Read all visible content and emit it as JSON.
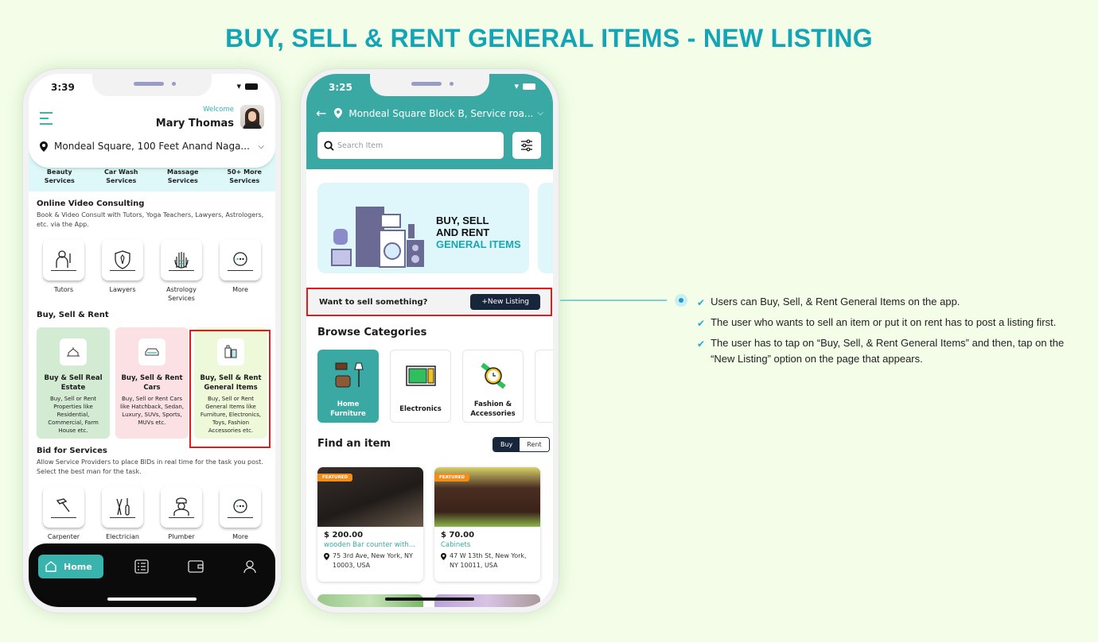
{
  "page": {
    "title": "BUY, SELL & RENT GENERAL ITEMS - NEW LISTING",
    "accent_color": "#14a5b5"
  },
  "left_phone": {
    "status_time": "3:39",
    "header": {
      "welcome": "Welcome",
      "user_name": "Mary Thomas",
      "location": "Mondeal Square, 100 Feet Anand Naga..."
    },
    "services_strip": [
      "Beauty Services",
      "Car Wash Services",
      "Massage Services",
      "50+ More Services"
    ],
    "online_video": {
      "title": "Online Video Consulting",
      "description": "Book & Video Consult with Tutors, Yoga Teachers, Lawyers, Astrologers, etc. via the App.",
      "items": [
        {
          "label": "Tutors",
          "icon": "tutor-icon"
        },
        {
          "label": "Lawyers",
          "icon": "lawyer-shield-icon"
        },
        {
          "label": "Astrology Services",
          "icon": "astrology-hand-icon"
        },
        {
          "label": "More",
          "icon": "more-icon"
        }
      ]
    },
    "buy_sell_rent": {
      "title": "Buy, Sell & Rent",
      "cards": [
        {
          "title": "Buy & Sell Real Estate",
          "description": "Buy, Sell or Rent Properties like Residential, Commercial, Farm House etc.",
          "bg": "#d3ebd3"
        },
        {
          "title": "Buy, Sell & Rent Cars",
          "description": "Buy, Sell or Rent Cars like Hatchback, Sedan, Luxury, SUVs, Sports, MUVs  etc.",
          "bg": "#fbe1e3"
        },
        {
          "title": "Buy, Sell & Rent General Items",
          "description": "Buy, Sell or Rent General Items like Furniture, Electronics, Toys, Fashion Accessories  etc.",
          "bg": "#eef9d9"
        }
      ]
    },
    "bid_services": {
      "title": "Bid for Services",
      "description": "Allow Service Providers to place BIDs in real time for the task you post. Select the best man for the task.",
      "items": [
        {
          "label": "Carpenter",
          "icon": "carpenter-hammer-icon"
        },
        {
          "label": "Electrician",
          "icon": "electrician-tools-icon"
        },
        {
          "label": "Plumber",
          "icon": "plumber-icon"
        },
        {
          "label": "More",
          "icon": "more-icon"
        }
      ]
    },
    "bottom_nav": {
      "home_label": "Home",
      "items": [
        "home-icon",
        "tasks-list-icon",
        "wallet-icon",
        "profile-icon"
      ]
    }
  },
  "right_phone": {
    "status_time": "3:25",
    "location": "Mondeal Square Block B, Service roa...",
    "search_placeholder": "Search Item",
    "banner": {
      "line1": "BUY, SELL",
      "line2": "AND RENT",
      "line3": "GENERAL ITEMS"
    },
    "sell_prompt": "Want to sell something?",
    "new_listing_label": "+New Listing",
    "browse_title": "Browse Categories",
    "categories": [
      {
        "label": "Home Furniture",
        "active": true
      },
      {
        "label": "Electronics",
        "active": false
      },
      {
        "label": "Fashion & Accessories",
        "active": false
      }
    ],
    "find_title": "Find an item",
    "toggle": {
      "buy": "Buy",
      "rent": "Rent",
      "selected": "Buy"
    },
    "items": [
      {
        "badge": "FEATURED",
        "price": "$ 200.00",
        "name": "wooden Bar counter with...",
        "address": "75 3rd Ave, New York, NY 10003, USA"
      },
      {
        "badge": "FEATURED",
        "price": "$ 70.00",
        "name": "Cabinets",
        "address": "47 W 13th St, New York, NY 10011, USA"
      }
    ]
  },
  "notes": [
    "Users can Buy, Sell, & Rent General Items on the app.",
    "The user who wants to sell an item or put it on rent has to post a listing first.",
    "The user has to tap on “Buy, Sell, & Rent General Items” and then, tap on the “New Listing” option on the page that appears."
  ]
}
